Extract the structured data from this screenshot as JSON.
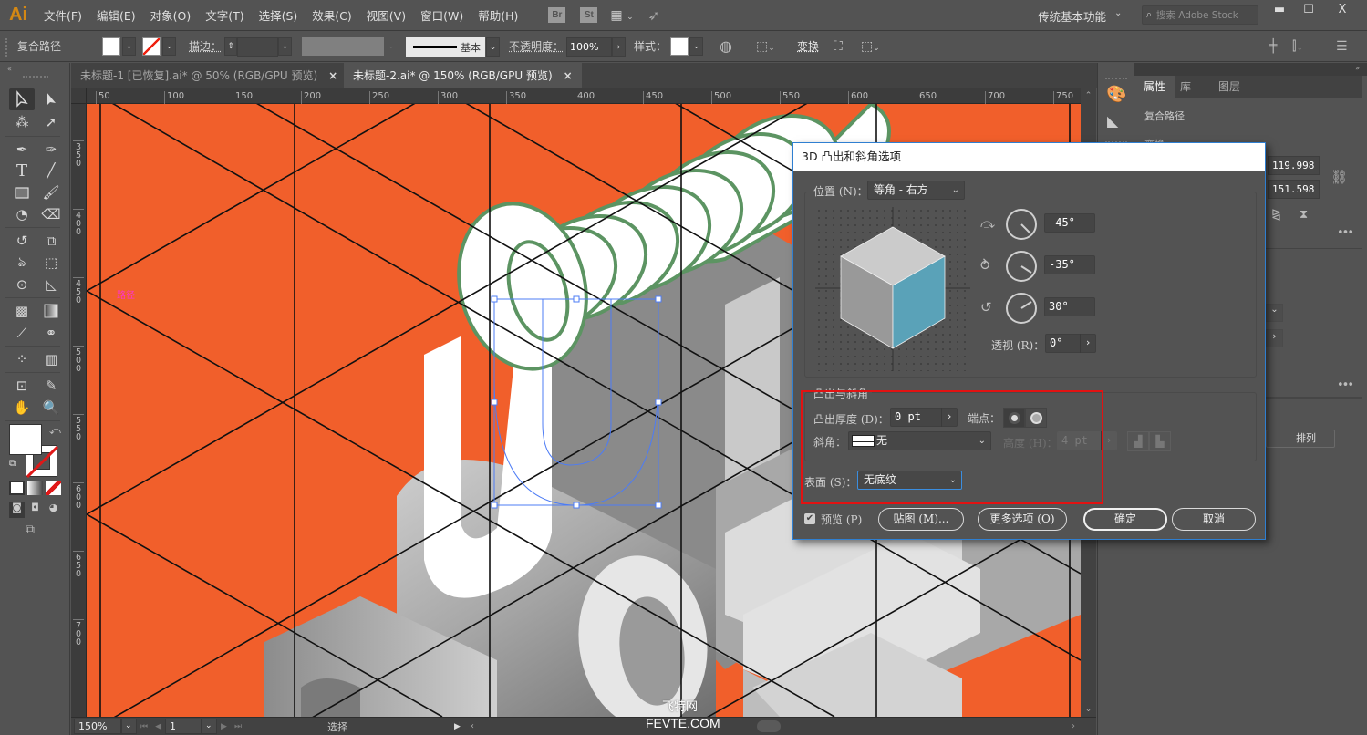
{
  "app": {
    "logo": "Ai",
    "menu": [
      "文件(F)",
      "编辑(E)",
      "对象(O)",
      "文字(T)",
      "选择(S)",
      "效果(C)",
      "视图(V)",
      "窗口(W)",
      "帮助(H)"
    ],
    "bridge_badge": "Br",
    "stock_badge": "St",
    "workspace": "传统基本功能",
    "search_placeholder": "搜索 Adobe Stock",
    "window_controls": {
      "minimize": "—",
      "maximize": "☐",
      "close": "X"
    }
  },
  "control_bar": {
    "object_type": "复合路径",
    "stroke_label": "描边：",
    "brush_profile": "基本",
    "opacity_label": "不透明度：",
    "opacity_value": "100%",
    "style_label": "样式：",
    "transform_label": "变换"
  },
  "doc_tabs": [
    {
      "label": "未标题-1 [已恢复].ai* @ 50% (RGB/GPU 预览)",
      "active": false
    },
    {
      "label": "未标题-2.ai* @ 150% (RGB/GPU 预览)",
      "active": true
    }
  ],
  "rulers": {
    "top": [
      "50",
      "100",
      "150",
      "200",
      "250",
      "300",
      "350",
      "400",
      "450",
      "500",
      "550",
      "600",
      "650",
      "700",
      "750"
    ],
    "left": [
      "350",
      "400",
      "450",
      "500",
      "550",
      "600",
      "650",
      "700"
    ]
  },
  "canvas": {
    "smart_guide_label": "路径",
    "background_color": "#f15f2b",
    "outline_color": "#5c9462",
    "selection_color": "#4d7cf5"
  },
  "status_bar": {
    "zoom": "150%",
    "artboard": "1",
    "tool_status": "选择"
  },
  "watermark": {
    "cn": "飞特网",
    "en": "FEVTE.COM"
  },
  "right_panel": {
    "tabs": [
      "属性",
      "库",
      "图层"
    ],
    "active_tab": "属性",
    "object_type": "复合路径",
    "section_transform": "变换",
    "width": "119.998",
    "height": "151.598",
    "arrange_button": "排列"
  },
  "dialog": {
    "title": "3D 凸出和斜角选项",
    "position_label": "位置 (N)：",
    "position_value": "等角 - 右方",
    "rotate_x": "-45°",
    "rotate_y": "-35°",
    "rotate_z": "30°",
    "perspective_label": "透视 (R)：",
    "perspective_value": "0°",
    "extrude_section": "凸出与斜角",
    "extrude_depth_label": "凸出厚度 (D)：",
    "extrude_depth_value": "0 pt",
    "cap_label": "端点：",
    "bevel_label": "斜角：",
    "bevel_value": "无",
    "bevel_height_label": "高度 (H)：",
    "bevel_height_value": "4 pt",
    "surface_label": "表面 (S)：",
    "surface_value": "无底纹",
    "preview_label": "预览 (P)",
    "preview_checked": true,
    "map_button": "贴图 (M)...",
    "more_button": "更多选项 (O)",
    "ok_button": "确定",
    "cancel_button": "取消",
    "cube_side_color": "#5aa2b8"
  }
}
